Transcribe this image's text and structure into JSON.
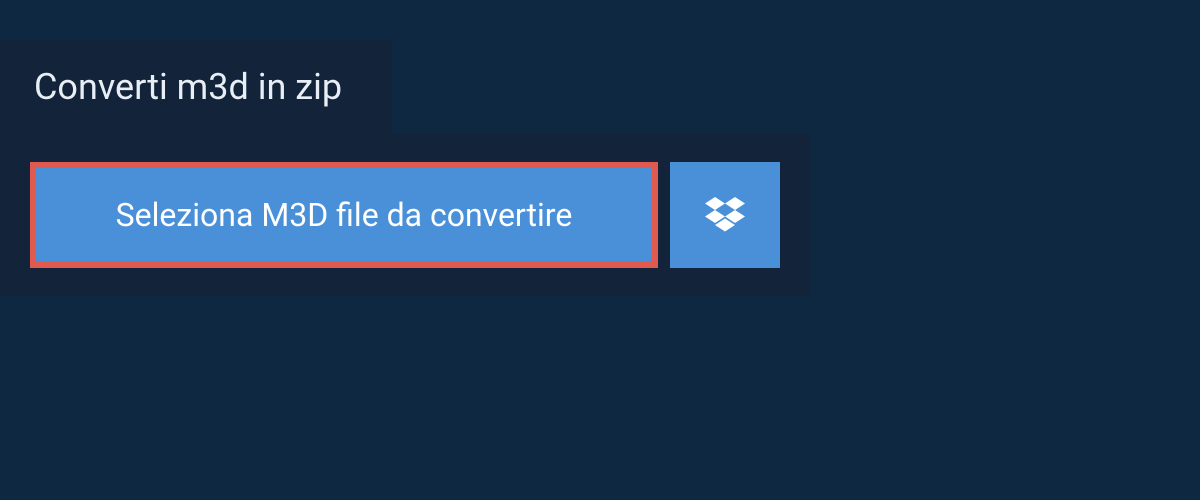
{
  "tab": {
    "title": "Converti m3d in zip"
  },
  "actions": {
    "select_file_label": "Seleziona M3D file da convertire"
  },
  "colors": {
    "background": "#0f2842",
    "panel": "#12233a",
    "button": "#4a90d9",
    "highlight_border": "#e05a4f",
    "text_light": "#e8eef5",
    "text_white": "#ffffff"
  }
}
